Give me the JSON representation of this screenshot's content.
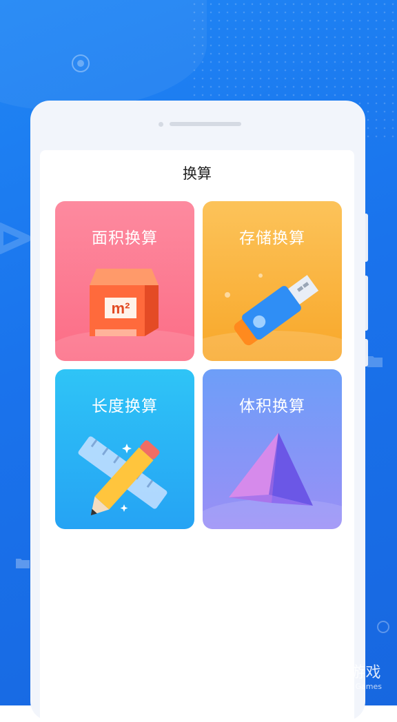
{
  "page": {
    "title": "换算"
  },
  "cards": [
    {
      "label": "面积换算",
      "icon": "area-cube-icon",
      "icon_text": "m²"
    },
    {
      "label": "存储换算",
      "icon": "usb-drive-icon"
    },
    {
      "label": "长度换算",
      "icon": "pencil-ruler-icon"
    },
    {
      "label": "体积换算",
      "icon": "pyramid-icon"
    }
  ],
  "watermark": {
    "main": "仍玩游戏",
    "sub": "Rengwan Games"
  },
  "colors": {
    "background": "#1a73ec",
    "area_card": "#fc6d86",
    "storage_card": "#f8a729",
    "length_card": "#25a3f4",
    "volume_card": "#8a95f7"
  }
}
